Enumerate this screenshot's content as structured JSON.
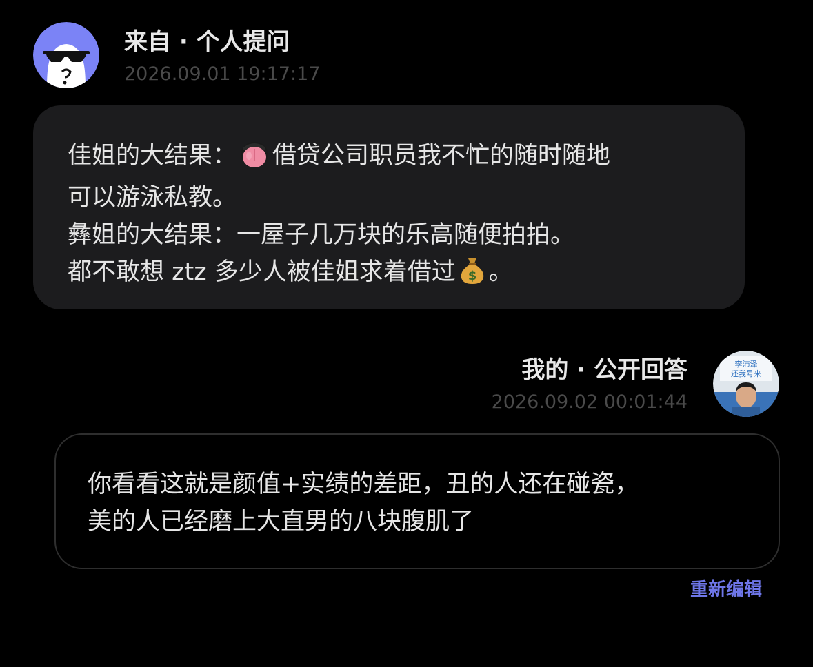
{
  "question": {
    "avatar_icon": "sunglasses-ghost-avatar",
    "title": "来自 · 个人提问",
    "timestamp": "2026.09.01 19:17:17",
    "line1_a": "佳姐的大结果：",
    "line1_emoji": "tongue-emoji",
    "line1_b": "借贷公司职员我不忙的随时随地",
    "line2": "可以游泳私教。",
    "line3": "彝姐的大结果：一屋子几万块的乐高随便拍拍。",
    "line4_a": "都不敢想 ztz 多少人被佳姐求着借过",
    "line4_emoji": "money-bag-emoji",
    "line4_b": "。"
  },
  "answer": {
    "title": "我的 · 公开回答",
    "timestamp": "2026.09.02 00:01:44",
    "avatar_sign_text": "李沛泽 还我号来",
    "line1": "你看看这就是颜值+实绩的差距，丑的人还在碰瓷，",
    "line2": "美的人已经磨上大直男的八块腹肌了"
  },
  "actions": {
    "re_edit_label": "重新编辑"
  },
  "colors": {
    "background": "#000000",
    "bubble": "#1c1c1e",
    "avatar_bg": "#7b83f6",
    "link": "#6e76e8",
    "timestamp": "#4a4a4a"
  }
}
